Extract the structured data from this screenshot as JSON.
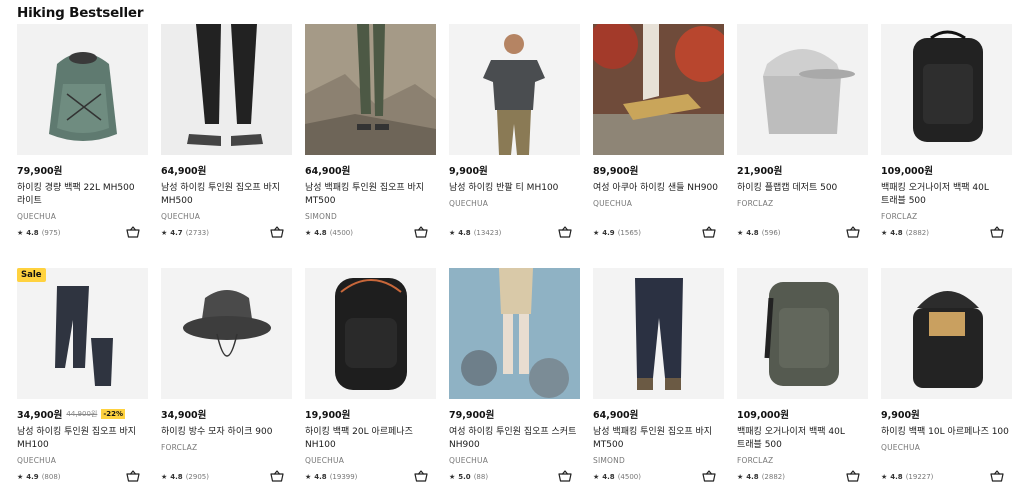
{
  "section": {
    "title": "Hiking Bestseller"
  },
  "colors": {
    "accent": "#ffd23f",
    "text": "#1a1a1a",
    "muted": "#777777"
  },
  "products": [
    {
      "price": "79,900원",
      "name": "하이킹 경량 백팩 22L MH500 라이트",
      "brand": "QUECHUA",
      "rating": "4.8",
      "reviews": "(975)",
      "image": "backpack-green",
      "sale": false
    },
    {
      "price": "64,900원",
      "name": "남성 하이킹 투인원 집오프 바지 MH500",
      "brand": "QUECHUA",
      "rating": "4.7",
      "reviews": "(2733)",
      "image": "zip-off-pants-black",
      "sale": false
    },
    {
      "price": "64,900원",
      "name": "남성 백패킹 투인원 집오프 바지 MT500",
      "brand": "SIMOND",
      "rating": "4.8",
      "reviews": "(4500)",
      "image": "hiker-on-rocks",
      "sale": false
    },
    {
      "price": "9,900원",
      "name": "남성 하이킹 반팔 티 MH100",
      "brand": "QUECHUA",
      "rating": "4.8",
      "reviews": "(13423)",
      "image": "man-tshirt",
      "sale": false
    },
    {
      "price": "89,900원",
      "name": "여성 아쿠아 하이킹 샌들 NH900",
      "brand": "QUECHUA",
      "rating": "4.9",
      "reviews": "(1565)",
      "image": "sandals-on-log",
      "sale": false
    },
    {
      "price": "21,900원",
      "name": "하이킹 플랩캡 데저트 500",
      "brand": "FORCLAZ",
      "rating": "4.8",
      "reviews": "(596)",
      "image": "flap-cap",
      "sale": false
    },
    {
      "price": "109,000원",
      "name": "백패킹 오거나이저 백팩 40L 트래블 500",
      "brand": "FORCLAZ",
      "rating": "4.8",
      "reviews": "(2882)",
      "image": "black-travel-pack",
      "sale": false
    },
    {
      "price": "34,900원",
      "old_price": "44,900원",
      "discount": "-22%",
      "sale_label": "Sale",
      "name": "남성 하이킹 투인원 집오프 바지 MH100",
      "brand": "QUECHUA",
      "rating": "4.9",
      "reviews": "(808)",
      "image": "pants-navy",
      "sale": true
    },
    {
      "price": "34,900원",
      "name": "하이킹 방수 모자 하이크 900",
      "brand": "FORCLAZ",
      "rating": "4.8",
      "reviews": "(2905)",
      "image": "bucket-hat",
      "sale": false
    },
    {
      "price": "19,900원",
      "name": "하이킹 백팩 20L 아르페나즈 NH100",
      "brand": "QUECHUA",
      "rating": "4.8",
      "reviews": "(19399)",
      "image": "daypack-black",
      "sale": false
    },
    {
      "price": "79,900원",
      "name": "여성 하이킹 투인원 집오프 스커트 NH900",
      "brand": "QUECHUA",
      "rating": "5.0",
      "reviews": "(88)",
      "image": "woman-river",
      "sale": false
    },
    {
      "price": "64,900원",
      "name": "남성 백패킹 투인원 집오프 바지 MT500",
      "brand": "SIMOND",
      "rating": "4.8",
      "reviews": "(4500)",
      "image": "pants-navy-legs",
      "sale": false
    },
    {
      "price": "109,000원",
      "name": "백패킹 오거나이저 백팩 40L 트래블 500",
      "brand": "FORCLAZ",
      "rating": "4.8",
      "reviews": "(2882)",
      "image": "khaki-travel-pack",
      "sale": false
    },
    {
      "price": "9,900원",
      "name": "하이킹 백팩 10L 아르페나즈 100",
      "brand": "QUECHUA",
      "rating": "4.8",
      "reviews": "(19227)",
      "image": "open-small-pack",
      "sale": false
    }
  ]
}
